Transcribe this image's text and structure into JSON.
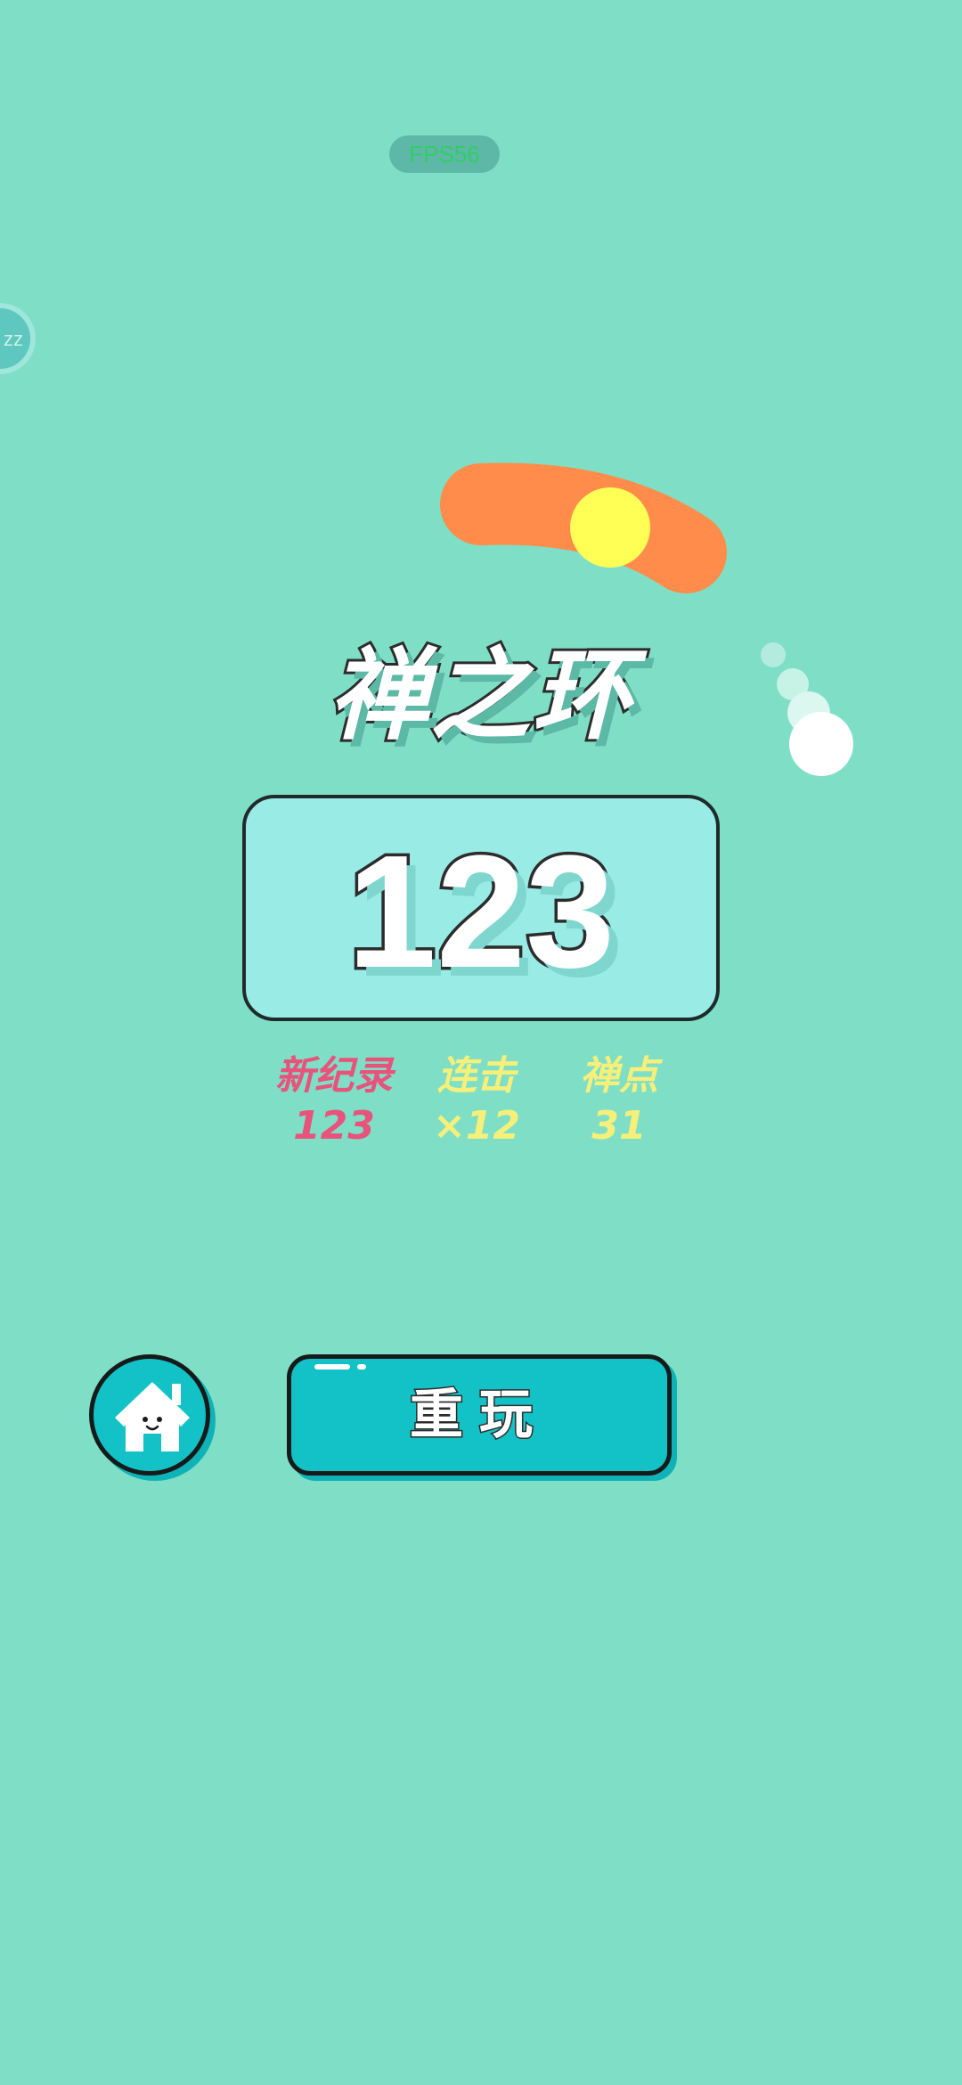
{
  "hud": {
    "fps_text": "FPS56",
    "side_badge_text": "zz"
  },
  "game": {
    "title": "禅之环",
    "score": "123",
    "stats": {
      "record": {
        "label": "新纪录",
        "value": "123"
      },
      "combo": {
        "label": "连击",
        "value": "×12"
      },
      "points": {
        "label": "禅点",
        "value": "31"
      }
    }
  },
  "buttons": {
    "home_icon": "home-icon",
    "replay_label": "重玩"
  },
  "colors": {
    "background": "#7fdfc6",
    "accent_teal": "#13c2c6",
    "record_pink": "#e8537c",
    "stat_yellow": "#f6f07a",
    "ring_orange": "#ff8c4a",
    "ball_yellow": "#ffff55"
  }
}
